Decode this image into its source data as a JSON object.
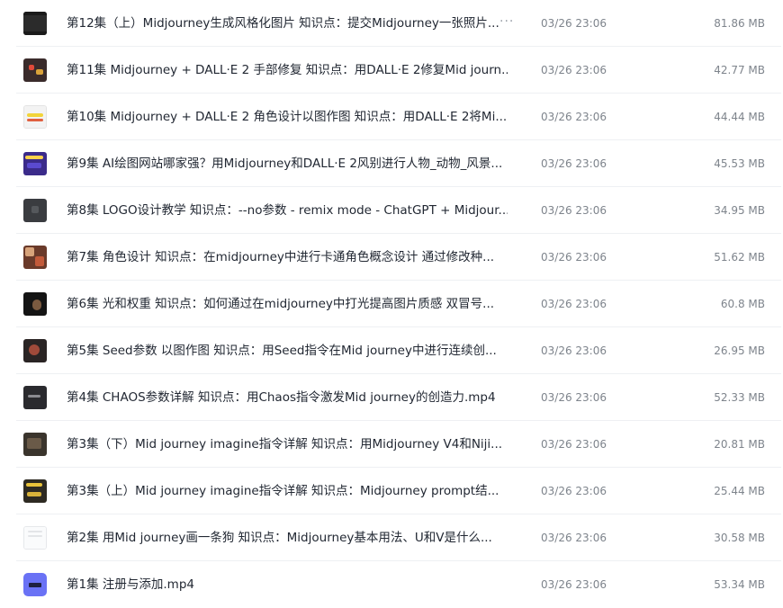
{
  "files": [
    {
      "name": "第12集（上）Midjourney生成风格化图片 知识点：提交Midjourney一张照片...",
      "date": "03/26 23:06",
      "size": "81.86 MB",
      "thumb": "t-dark",
      "more": "···"
    },
    {
      "name": "第11集 Midjourney + DALL·E 2 手部修复 知识点：用DALL·E 2修复Mid journ...",
      "date": "03/26 23:06",
      "size": "42.77 MB",
      "thumb": "t-red"
    },
    {
      "name": "第10集 Midjourney + DALL·E 2 角色设计以图作图 知识点：用DALL·E 2将Mi...",
      "date": "03/26 23:06",
      "size": "44.44 MB",
      "thumb": "t-yellow"
    },
    {
      "name": "第9集 AI绘图网站哪家强？用Midjourney和DALL·E 2风别进行人物_动物_风景...",
      "date": "03/26 23:06",
      "size": "45.53 MB",
      "thumb": "t-purple"
    },
    {
      "name": "第8集 LOGO设计教学 知识点：--no参数 - remix mode - ChatGPT + Midjour...",
      "date": "03/26 23:06",
      "size": "34.95 MB",
      "thumb": "t-grey"
    },
    {
      "name": "第7集 角色设计 知识点：在midjourney中进行卡通角色概念设计 通过修改种...",
      "date": "03/26 23:06",
      "size": "51.62 MB",
      "thumb": "t-mosaic"
    },
    {
      "name": "第6集 光和权重 知识点：如何通过在midjourney中打光提高图片质感 双冒号...",
      "date": "03/26 23:06",
      "size": "60.8 MB",
      "thumb": "t-black"
    },
    {
      "name": "第5集 Seed参数 以图作图 知识点：用Seed指令在Mid journey中进行连续创...",
      "date": "03/26 23:06",
      "size": "26.95 MB",
      "thumb": "t-brown"
    },
    {
      "name": "第4集 CHAOS参数详解 知识点：用Chaos指令激发Mid journey的创造力.mp4",
      "date": "03/26 23:06",
      "size": "52.33 MB",
      "thumb": "t-ink"
    },
    {
      "name": "第3集（下）Mid journey imagine指令详解 知识点：用Midjourney V4和Niji...",
      "date": "03/26 23:06",
      "size": "20.81 MB",
      "thumb": "t-tan"
    },
    {
      "name": "第3集（上）Mid journey imagine指令详解 知识点：Midjourney prompt结...",
      "date": "03/26 23:06",
      "size": "25.44 MB",
      "thumb": "t-gold"
    },
    {
      "name": "第2集 用Mid journey画一条狗 知识点：Midjourney基本用法、U和V是什么...",
      "date": "03/26 23:06",
      "size": "30.58 MB",
      "thumb": "t-doc"
    },
    {
      "name": "第1集 注册与添加.mp4",
      "date": "03/26 23:06",
      "size": "53.34 MB",
      "thumb": "t-video"
    }
  ]
}
